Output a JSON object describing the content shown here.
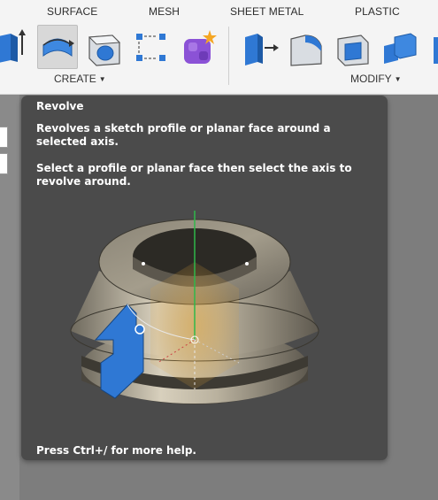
{
  "tabs": [
    "SURFACE",
    "MESH",
    "SHEET METAL",
    "PLASTIC"
  ],
  "groups": {
    "create": "CREATE",
    "modify": "MODIFY"
  },
  "icons": {
    "create": [
      "extrude-icon",
      "revolve-icon",
      "hole-icon",
      "pattern-icon",
      "create-form-icon"
    ],
    "modify": [
      "press-pull-icon",
      "fillet-icon",
      "shell-icon",
      "combine-icon"
    ]
  },
  "tooltip": {
    "title": "Revolve",
    "description": "Revolves a sketch profile or planar face around a selected axis.",
    "instruction": "Select a profile or planar face then select the axis to revolve around.",
    "help": "Press Ctrl+/ for more help."
  },
  "colors": {
    "tooltip_bg": "#4b4b4b",
    "accent_blue": "#2f78d4",
    "axis_green": "#2fb84a",
    "toolbar_bg": "#f4f4f4"
  }
}
